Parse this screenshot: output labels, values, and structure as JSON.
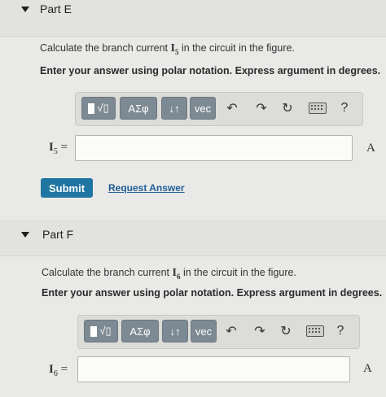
{
  "parts": [
    {
      "title": "Part E",
      "question_pre": "Calculate the branch current ",
      "question_var": "I",
      "question_sub": "5",
      "question_post": " in the circuit in the figure.",
      "instruction": "Enter your answer using polar notation. Express argument in degrees.",
      "toolbar": {
        "templates_label": "√▯",
        "greek_label": "ΑΣφ",
        "arrows_label": "↓↑",
        "vec_label": "vec",
        "help_label": "?"
      },
      "answer_label_var": "I",
      "answer_label_sub": "5",
      "answer_label_eq": " =",
      "answer_value": "",
      "unit": "A",
      "submit_label": "Submit",
      "request_answer_label": "Request Answer"
    },
    {
      "title": "Part F",
      "question_pre": "Calculate the branch current ",
      "question_var": "I",
      "question_sub": "6",
      "question_post": " in the circuit in the figure.",
      "instruction": "Enter your answer using polar notation. Express argument in degrees.",
      "toolbar": {
        "templates_label": "√▯",
        "greek_label": "ΑΣφ",
        "arrows_label": "↓↑",
        "vec_label": "vec",
        "help_label": "?"
      },
      "answer_label_var": "I",
      "answer_label_sub": "6",
      "answer_label_eq": " =",
      "answer_value": "",
      "unit": "A"
    }
  ],
  "icons": {
    "collapse": "triangle-down-icon",
    "undo": "undo-icon",
    "redo": "redo-icon",
    "reset": "reset-icon",
    "keyboard": "keyboard-icon"
  }
}
